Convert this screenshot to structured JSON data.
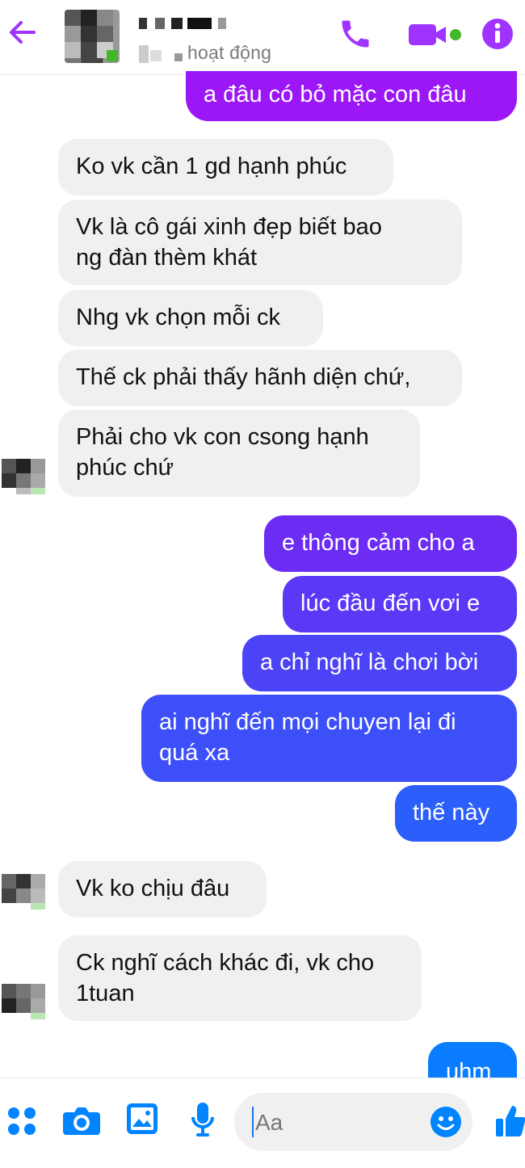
{
  "header": {
    "status_text": "hoạt động",
    "icons": [
      "back-arrow-icon",
      "phone-icon",
      "video-camera-icon",
      "info-icon"
    ]
  },
  "colors": {
    "accent": "#a033ff",
    "gradient_top": "#9b17f5",
    "gradient_mid": "#4a44f7",
    "gradient_bottom": "#0a7cff",
    "incoming_bg": "#f1f0f0",
    "composer_icon": "#0084ff",
    "online": "#42b72a"
  },
  "messages": [
    {
      "text": "a đâu có bỏ mặc con đâu",
      "direction": "out"
    },
    {
      "text": "Ko vk cần 1 gd hạnh phúc",
      "direction": "in"
    },
    {
      "text": "Vk là cô gái xinh đẹp biết bao\nng đàn thèm khát",
      "direction": "in"
    },
    {
      "text": "Nhg vk chọn mỗi ck",
      "direction": "in"
    },
    {
      "text": "Thế ck phải thấy hãnh diện chứ,",
      "direction": "in"
    },
    {
      "text": "Phải cho vk con csong hạnh\nphúc chứ",
      "direction": "in"
    },
    {
      "text": "e thông cảm cho a",
      "direction": "out"
    },
    {
      "text": "lúc đầu đến vơi e",
      "direction": "out"
    },
    {
      "text": "a chỉ nghĩ là chơi bời",
      "direction": "out"
    },
    {
      "text": "ai nghĩ đến mọi chuyen lại đi\nquá xa",
      "direction": "out"
    },
    {
      "text": "thế này",
      "direction": "out"
    },
    {
      "text": "Vk ko chịu đâu",
      "direction": "in"
    },
    {
      "text": "Ck nghĩ cách khác đi, vk cho\n1tuan",
      "direction": "in"
    },
    {
      "text": "uhm",
      "direction": "out"
    }
  ],
  "composer": {
    "placeholder": "Aa",
    "icons": [
      "apps-grid-icon",
      "camera-icon",
      "gallery-icon",
      "microphone-icon",
      "emoji-icon",
      "thumbs-up-icon"
    ]
  }
}
